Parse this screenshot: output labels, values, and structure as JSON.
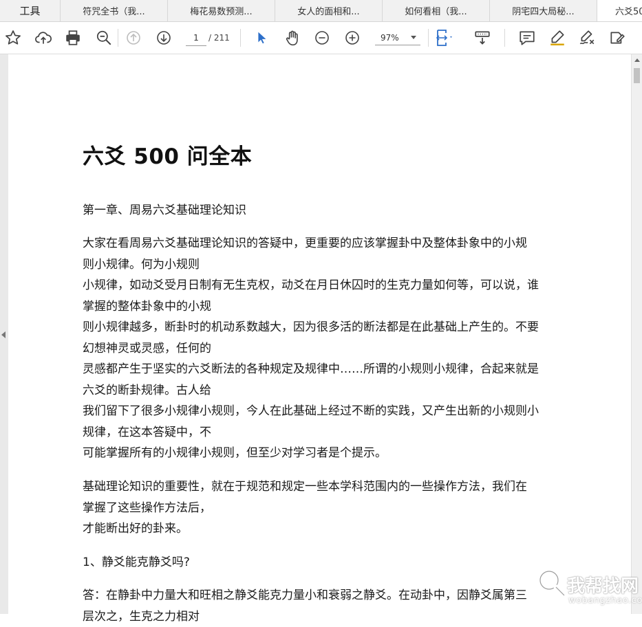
{
  "tabs": {
    "tools_label": "工具",
    "documents": [
      {
        "label": "符咒全书（我..."
      },
      {
        "label": "梅花易数预测..."
      },
      {
        "label": "女人的面相和..."
      },
      {
        "label": "如何看相（我..."
      },
      {
        "label": "阴宅四大局秘..."
      }
    ],
    "active_label": "六爻50"
  },
  "toolbar": {
    "current_page": "1",
    "total_pages": "/ 211",
    "zoom": "97%",
    "icons": [
      "star-icon",
      "cloud-upload-icon",
      "print-icon",
      "zoom-search-icon",
      "page-up-icon",
      "page-down-icon",
      "select-cursor-icon",
      "hand-icon",
      "zoom-out-icon",
      "zoom-in-icon",
      "fit-page-icon",
      "scroll-mode-icon",
      "comment-icon",
      "highlight-pen-icon",
      "sign-icon",
      "fill-sign-icon"
    ],
    "accent_color": "#2d6fc9"
  },
  "document": {
    "title": "六爻 500 问全本",
    "chapter": "第一章、周易六爻基础理论知识",
    "para1": [
      " 大家在看周易六爻基础理论知识的答疑中，更重要的应该掌握卦中及整体卦象中的小规",
      "则小规律。何为小规则",
      "小规律，如动爻受月日制有无生克权，动爻在月日休囚时的生克力量如何等，可以说，谁",
      "掌握的整体卦象中的小规",
      "则小规律越多，断卦时的机动系数越大，因为很多活的断法都是在此基础上产生的。不要",
      "幻想神灵或灵感，任何的",
      "灵感都产生于坚实的六爻断法的各种规定及规律中……所谓的小规则小规律，合起来就是",
      "六爻的断卦规律。古人给",
      "我们留下了很多小规律小规则，今人在此基础上经过不断的实践，又产生出新的小规则小",
      "规律，在这本答疑中，不",
      "可能掌握所有的小规律小规则，但至少对学习者是个提示。"
    ],
    "para2": [
      " 基础理论知识的重要性，就在于规范和规定一些本学科范围内的一些操作方法，我们在",
      "掌握了这些操作方法后，",
      "才能断出好的卦来。"
    ],
    "q1": " 1、静爻能克静爻吗?",
    "a1": [
      " 答：在静卦中力量大和旺相之静爻能克力量小和衰弱之静爻。在动卦中，因静爻属第三",
      "层次之，生克之力相对"
    ]
  },
  "watermark": {
    "logo": "我帮找网",
    "url": "wobangzhao.com"
  }
}
